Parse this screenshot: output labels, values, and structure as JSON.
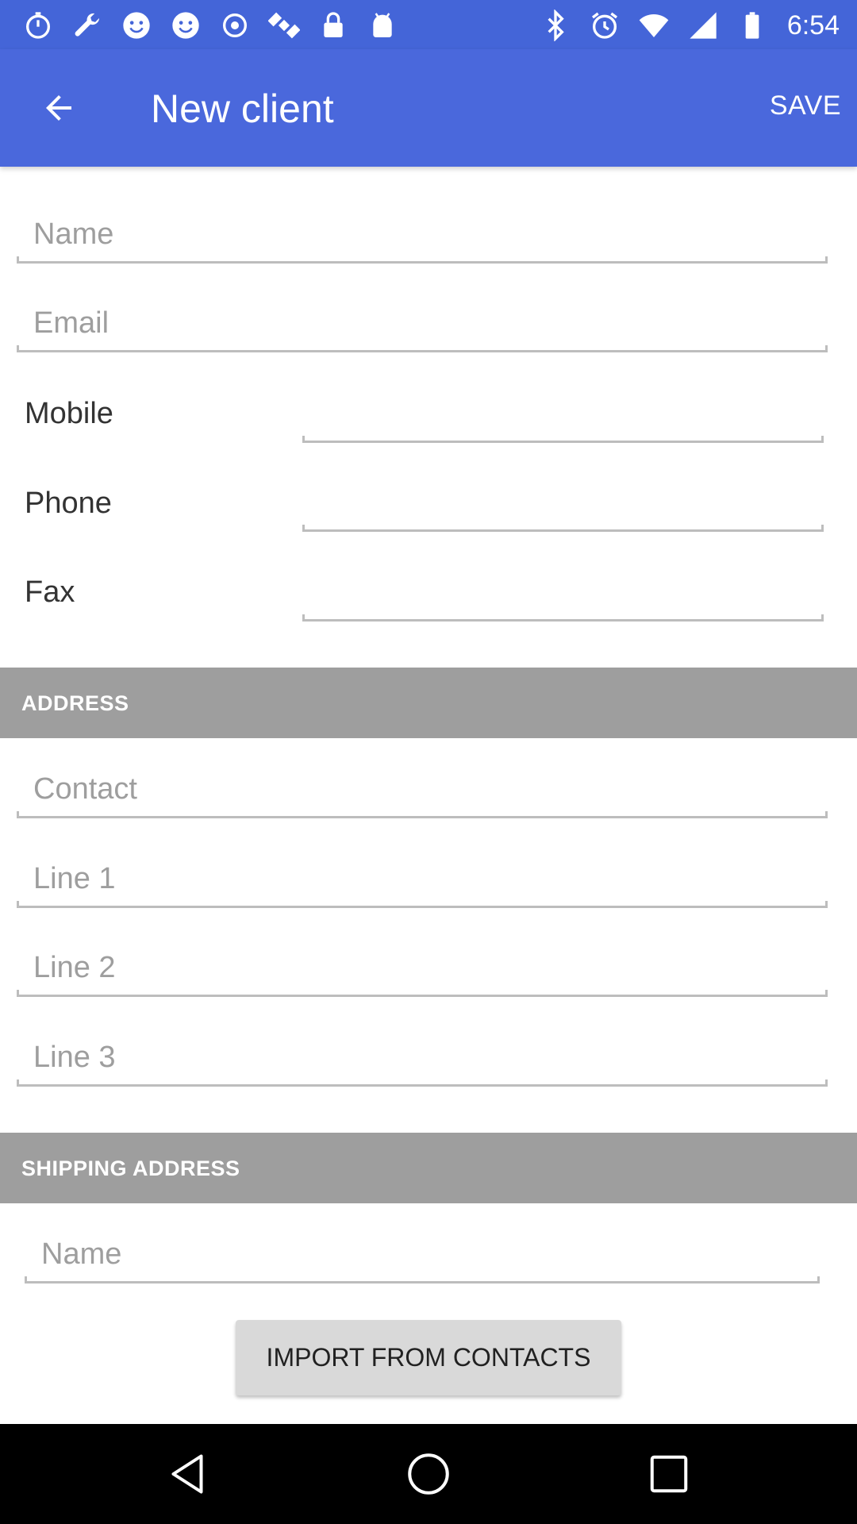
{
  "status_bar": {
    "time": "6:54",
    "left_icons": [
      "timer-icon",
      "wrench-icon",
      "smiley-icon",
      "smiley-icon",
      "record-icon",
      "satellite-icon",
      "lock-icon",
      "android-icon"
    ],
    "right_icons": [
      "bluetooth-icon",
      "alarm-icon",
      "wifi-icon",
      "signal-icon",
      "battery-icon"
    ]
  },
  "app_bar": {
    "title": "New client",
    "save_label": "SAVE",
    "back_icon": "arrow-back-icon"
  },
  "client_fields": {
    "name_placeholder": "Name",
    "email_placeholder": "Email",
    "mobile_label": "Mobile",
    "phone_label": "Phone",
    "fax_label": "Fax"
  },
  "address_section": {
    "header": "ADDRESS",
    "contact_placeholder": "Contact",
    "line1_placeholder": "Line 1",
    "line2_placeholder": "Line 2",
    "line3_placeholder": "Line 3"
  },
  "shipping_section": {
    "header": "SHIPPING ADDRESS",
    "name_placeholder": "Name"
  },
  "import_button_label": "IMPORT FROM CONTACTS",
  "colors": {
    "app_bar": "#4a68dc",
    "status_bar": "#4465d8",
    "section_header": "#9e9e9e",
    "underline": "#bdbdbd"
  }
}
